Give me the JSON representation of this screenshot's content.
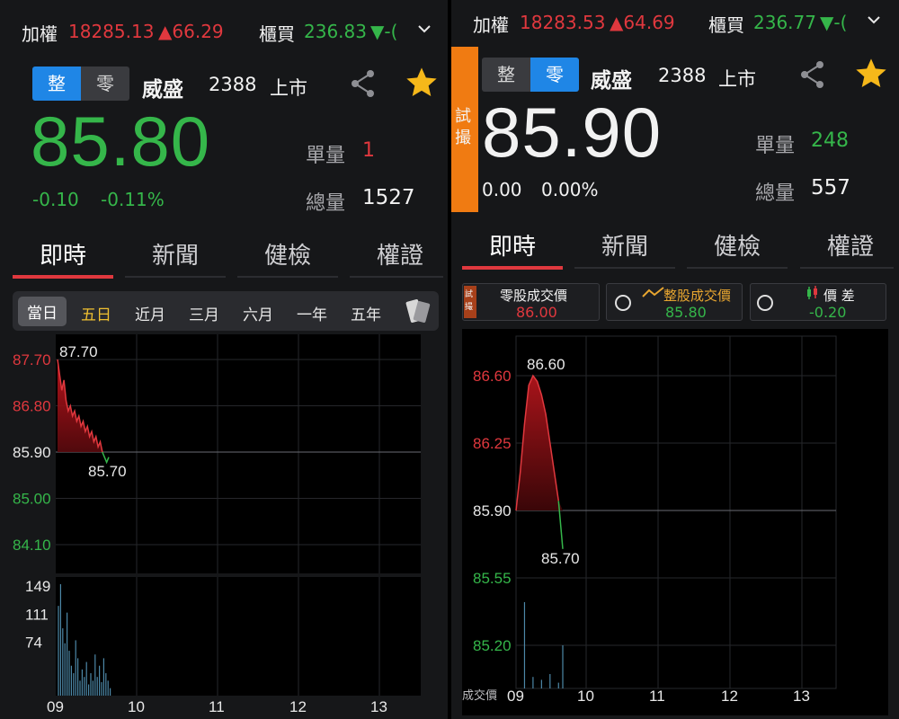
{
  "left": {
    "ticker": {
      "taiex_label": "加權",
      "taiex_value": "18285.13",
      "taiex_change": "▲66.29",
      "otc_label": "櫃買",
      "otc_value": "236.83",
      "otc_change": "▼-("
    },
    "toggle": {
      "whole": "整",
      "odd": "零",
      "active": "whole"
    },
    "stock": {
      "name": "威盛",
      "code": "2388",
      "market": "上市"
    },
    "price": "85.80",
    "change": "-0.10",
    "change_pct": "-0.11%",
    "unit_vol_label": "單量",
    "unit_vol": "1",
    "total_vol_label": "總量",
    "total_vol": "1527",
    "tabs": [
      "即時",
      "新聞",
      "健檢",
      "權證"
    ],
    "ranges": [
      "當日",
      "五日",
      "近月",
      "三月",
      "六月",
      "一年",
      "五年"
    ],
    "range_selected": "當日",
    "chart_data": {
      "type": "line",
      "y_labels": [
        "87.70",
        "86.80",
        "85.90",
        "85.00",
        "84.10"
      ],
      "ref_price": 85.9,
      "ylim": [
        84.1,
        87.7
      ],
      "x_labels": [
        "09",
        "10",
        "11",
        "12",
        "13"
      ],
      "annotations": {
        "high": "87.70",
        "low": "85.70"
      },
      "price_series": [
        87.7,
        87.4,
        87.1,
        87.3,
        86.9,
        86.7,
        86.8,
        86.6,
        86.7,
        86.5,
        86.6,
        86.4,
        86.5,
        86.3,
        86.4,
        86.2,
        86.3,
        86.1,
        86.2,
        86.0,
        86.1,
        85.9,
        85.8,
        85.7,
        85.8
      ],
      "volume_labels": [
        "149",
        "111",
        "74"
      ],
      "volume_max": 149,
      "volume_series": [
        120,
        149,
        90,
        70,
        111,
        60,
        40,
        30,
        74,
        50,
        20,
        35,
        25,
        45,
        15,
        30,
        20,
        55,
        25,
        40,
        18,
        50,
        30,
        20,
        10
      ]
    }
  },
  "right": {
    "ticker": {
      "taiex_label": "加權",
      "taiex_value": "18283.53",
      "taiex_change": "▲64.69",
      "otc_label": "櫃買",
      "otc_value": "236.77",
      "otc_change": "▼-("
    },
    "trial_badge": "試撮",
    "toggle": {
      "whole": "整",
      "odd": "零",
      "active": "odd"
    },
    "stock": {
      "name": "威盛",
      "code": "2388",
      "market": "上市"
    },
    "price": "85.90",
    "change": "0.00",
    "change_pct": "0.00%",
    "unit_vol_label": "單量",
    "unit_vol": "248",
    "total_vol_label": "總量",
    "total_vol": "557",
    "tabs": [
      "即時",
      "新聞",
      "健檢",
      "權證"
    ],
    "compare": {
      "odd_label": "零股成交價",
      "odd_value": "86.00",
      "whole_label": "整股成交價",
      "whole_value": "85.80",
      "diff_label": "價 差",
      "diff_value": "-0.20",
      "badge": "試撮"
    },
    "chart_data": {
      "type": "line",
      "y_labels": [
        "86.60",
        "86.25",
        "85.90",
        "85.55",
        "85.20"
      ],
      "ref_price": 85.9,
      "ylim": [
        85.2,
        86.6
      ],
      "x_labels": [
        "09",
        "10",
        "11",
        "12",
        "13"
      ],
      "x_axis_prefix": "成交價",
      "annotations": {
        "high": "86.60",
        "low": "85.70"
      },
      "price_series": [
        85.9,
        86.1,
        86.35,
        86.55,
        86.6,
        86.57,
        86.5,
        86.4,
        86.25,
        86.1,
        85.95,
        85.7
      ],
      "volume_series": [
        0,
        0,
        60,
        0,
        8,
        0,
        6,
        0,
        10,
        0,
        4,
        30
      ]
    }
  }
}
